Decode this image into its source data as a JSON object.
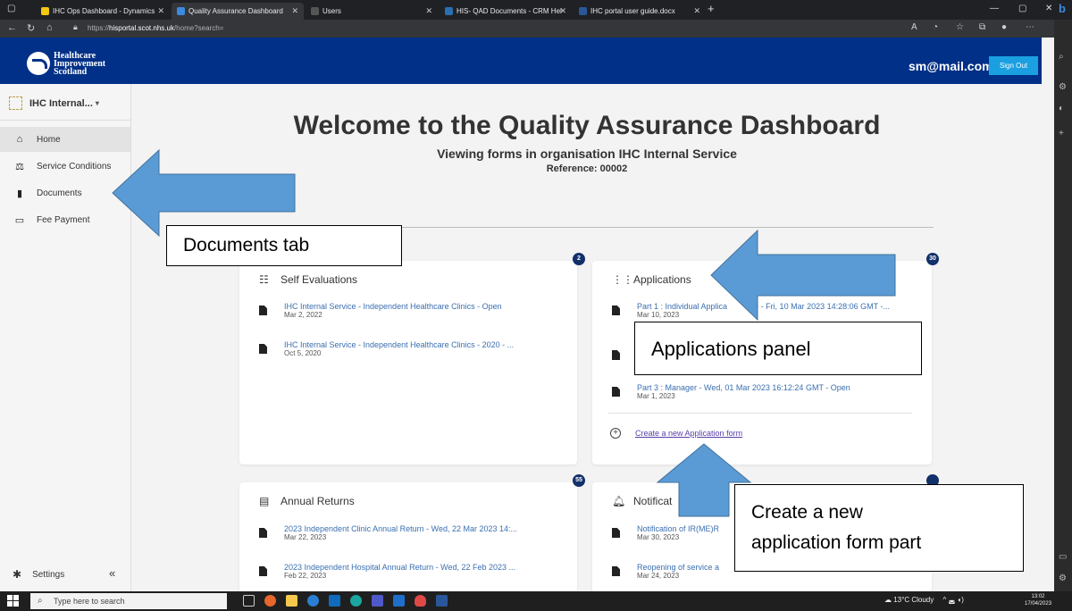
{
  "browser": {
    "tabs": [
      {
        "label": "IHC Ops Dashboard - Dynamics",
        "active": false,
        "color": "#f2c811"
      },
      {
        "label": "Quality Assurance Dashboard",
        "active": true,
        "color": "#3a8be0"
      },
      {
        "label": "Users",
        "active": false,
        "color": "#555555"
      },
      {
        "label": "HIS- QAD Documents - CRM Hel",
        "active": false,
        "color": "#2a6fb0"
      },
      {
        "label": "IHC portal user guide.docx",
        "active": false,
        "color": "#2b579a"
      }
    ],
    "url_prefix": "https://",
    "url_host": "hisportal.scot.nhs.uk",
    "url_path": "/home?search="
  },
  "header": {
    "logo_text": "Healthcare\nImprovement\nScotland",
    "user_email": "sm@mail.com",
    "sign_out": "Sign Out",
    "bg": "#003087"
  },
  "sidebar": {
    "org": "IHC Internal...",
    "items": [
      {
        "label": "Home",
        "icon": "home-icon",
        "active": true
      },
      {
        "label": "Service Conditions",
        "icon": "gavel-icon",
        "active": false
      },
      {
        "label": "Documents",
        "icon": "document-icon",
        "active": false
      },
      {
        "label": "Fee Payment",
        "icon": "card-icon",
        "active": false
      }
    ],
    "settings": "Settings",
    "collapse": "«"
  },
  "main": {
    "title": "Welcome to the Quality Assurance Dashboard",
    "subtitle": "Viewing forms in organisation IHC Internal Service",
    "reference": "Reference: 00002"
  },
  "self_evaluations": {
    "title": "Self Evaluations",
    "count": "2",
    "entries": [
      {
        "label": "IHC Internal Service - Independent Healthcare Clinics - Open",
        "date": "Mar 2, 2022"
      },
      {
        "label": "IHC Internal Service - Independent Healthcare Clinics - 2020 - ...",
        "date": "Oct 5, 2020"
      }
    ]
  },
  "applications": {
    "title": "Applications",
    "count": "30",
    "entries": [
      {
        "label": "Part 1 : Individual Applica",
        "label_tail": "e - Fri, 10 Mar 2023 14:28:06 GMT -...",
        "date": "Mar 10, 2023"
      },
      {
        "label": "Part 3 : Manager - Wed, 01 Mar 2023 16:12:24 GMT - Open",
        "date": "Mar 1, 2023"
      }
    ],
    "create_link": "Create a new Application form"
  },
  "annual_returns": {
    "title": "Annual Returns",
    "count": "55",
    "entries": [
      {
        "label": "2023 Independent Clinic Annual Return - Wed, 22 Mar 2023 14:...",
        "date": "Mar 22, 2023"
      },
      {
        "label": "2023 Independent Hospital Annual Return - Wed, 22 Feb 2023 ...",
        "date": "Feb 22, 2023"
      }
    ]
  },
  "notifications": {
    "title": "Notificat",
    "entries": [
      {
        "label": "Notification of IR(ME)R",
        "date": "Mar 30, 2023"
      },
      {
        "label": "Reopening of service a",
        "date": "Mar 24, 2023"
      }
    ]
  },
  "annotations": {
    "documents_tab": "Documents tab",
    "applications_panel": "Applications panel",
    "create_part_line1": "Create a new",
    "create_part_line2": "application form part",
    "arrow_color": "#5b9bd5"
  },
  "taskbar": {
    "search": "Type here to search",
    "weather": "13°C Cloudy",
    "time": "13:02",
    "date": "17/04/2023"
  }
}
